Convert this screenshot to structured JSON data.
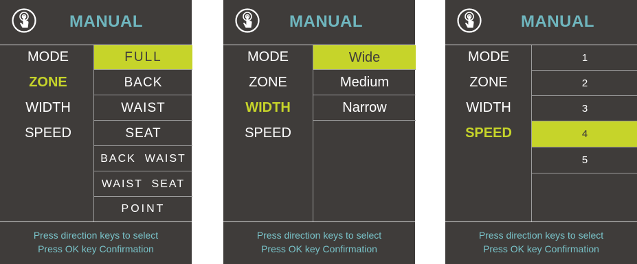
{
  "colors": {
    "background": "#3f3c3a",
    "accent": "#c6d42a",
    "title": "#6fb6be",
    "footer_text": "#79c3c9"
  },
  "panels": [
    {
      "icon": "touch-icon",
      "title": "MANUAL",
      "menu": [
        "MODE",
        "ZONE",
        "WIDTH",
        "SPEED"
      ],
      "active_menu": "ZONE",
      "options": [
        "FULL",
        "BACK",
        "WAIST",
        "SEAT",
        "BACK  WAIST",
        "WAIST  SEAT",
        "POINT"
      ],
      "selected_option": "FULL",
      "footer": {
        "line1": "Press direction keys to select",
        "line2": "Press OK key Confirmation"
      }
    },
    {
      "icon": "touch-icon",
      "title": "MANUAL",
      "menu": [
        "MODE",
        "ZONE",
        "WIDTH",
        "SPEED"
      ],
      "active_menu": "WIDTH",
      "options": [
        "Wide",
        "Medium",
        "Narrow"
      ],
      "selected_option": "Wide",
      "footer": {
        "line1": "Press direction keys to select",
        "line2": "Press OK key Confirmation"
      }
    },
    {
      "icon": "touch-icon",
      "title": "MANUAL",
      "menu": [
        "MODE",
        "ZONE",
        "WIDTH",
        "SPEED"
      ],
      "active_menu": "SPEED",
      "options": [
        "1",
        "2",
        "3",
        "4",
        "5"
      ],
      "selected_option": "4",
      "footer": {
        "line1": "Press direction keys to select",
        "line2": "Press OK key Confirmation"
      }
    }
  ]
}
